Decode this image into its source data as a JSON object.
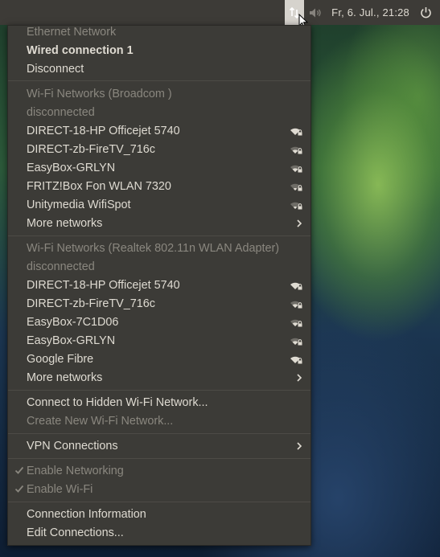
{
  "panel": {
    "clock": "Fr,  6. Jul., 21:28",
    "network_icon": "network-updown-icon",
    "sound_icon": "speaker-icon",
    "power_icon": "power-icon"
  },
  "menu": {
    "ethernet": {
      "header": "Ethernet Network",
      "connection": "Wired connection 1",
      "disconnect": "Disconnect"
    },
    "wifi_broadcom": {
      "header": "Wi-Fi Networks (Broadcom )",
      "status": "disconnected",
      "networks": [
        {
          "name": "DIRECT-18-HP Officejet 5740",
          "signal": "wifi-secure-icon"
        },
        {
          "name": "DIRECT-zb-FireTV_716c",
          "signal": "wifi-secure-icon"
        },
        {
          "name": "EasyBox-GRLYN",
          "signal": "wifi-secure-icon"
        },
        {
          "name": "FRITZ!Box Fon WLAN 7320",
          "signal": "wifi-secure-icon"
        },
        {
          "name": "Unitymedia WifiSpot",
          "signal": "wifi-secure-icon"
        }
      ],
      "more": "More networks"
    },
    "wifi_realtek": {
      "header": "Wi-Fi Networks (Realtek 802.11n WLAN Adapter)",
      "status": "disconnected",
      "networks": [
        {
          "name": "DIRECT-18-HP Officejet 5740",
          "signal": "wifi-secure-icon"
        },
        {
          "name": "DIRECT-zb-FireTV_716c",
          "signal": "wifi-secure-icon"
        },
        {
          "name": "EasyBox-7C1D06",
          "signal": "wifi-secure-icon"
        },
        {
          "name": "EasyBox-GRLYN",
          "signal": "wifi-secure-icon"
        },
        {
          "name": "Google Fibre",
          "signal": "wifi-secure-icon"
        }
      ],
      "more": "More networks"
    },
    "connect_hidden": "Connect to Hidden Wi-Fi Network...",
    "create_new": "Create New Wi-Fi Network...",
    "vpn": "VPN Connections",
    "enable_networking": "Enable Networking",
    "enable_wifi": "Enable Wi-Fi",
    "connection_info": "Connection Information",
    "edit_connections": "Edit Connections..."
  },
  "colors": {
    "panel_bg": "#3d3b37",
    "menu_bg": "#3c3b37",
    "text": "#dfdbd2",
    "disabled_text": "#8a877f",
    "separator": "#4d4b46"
  }
}
